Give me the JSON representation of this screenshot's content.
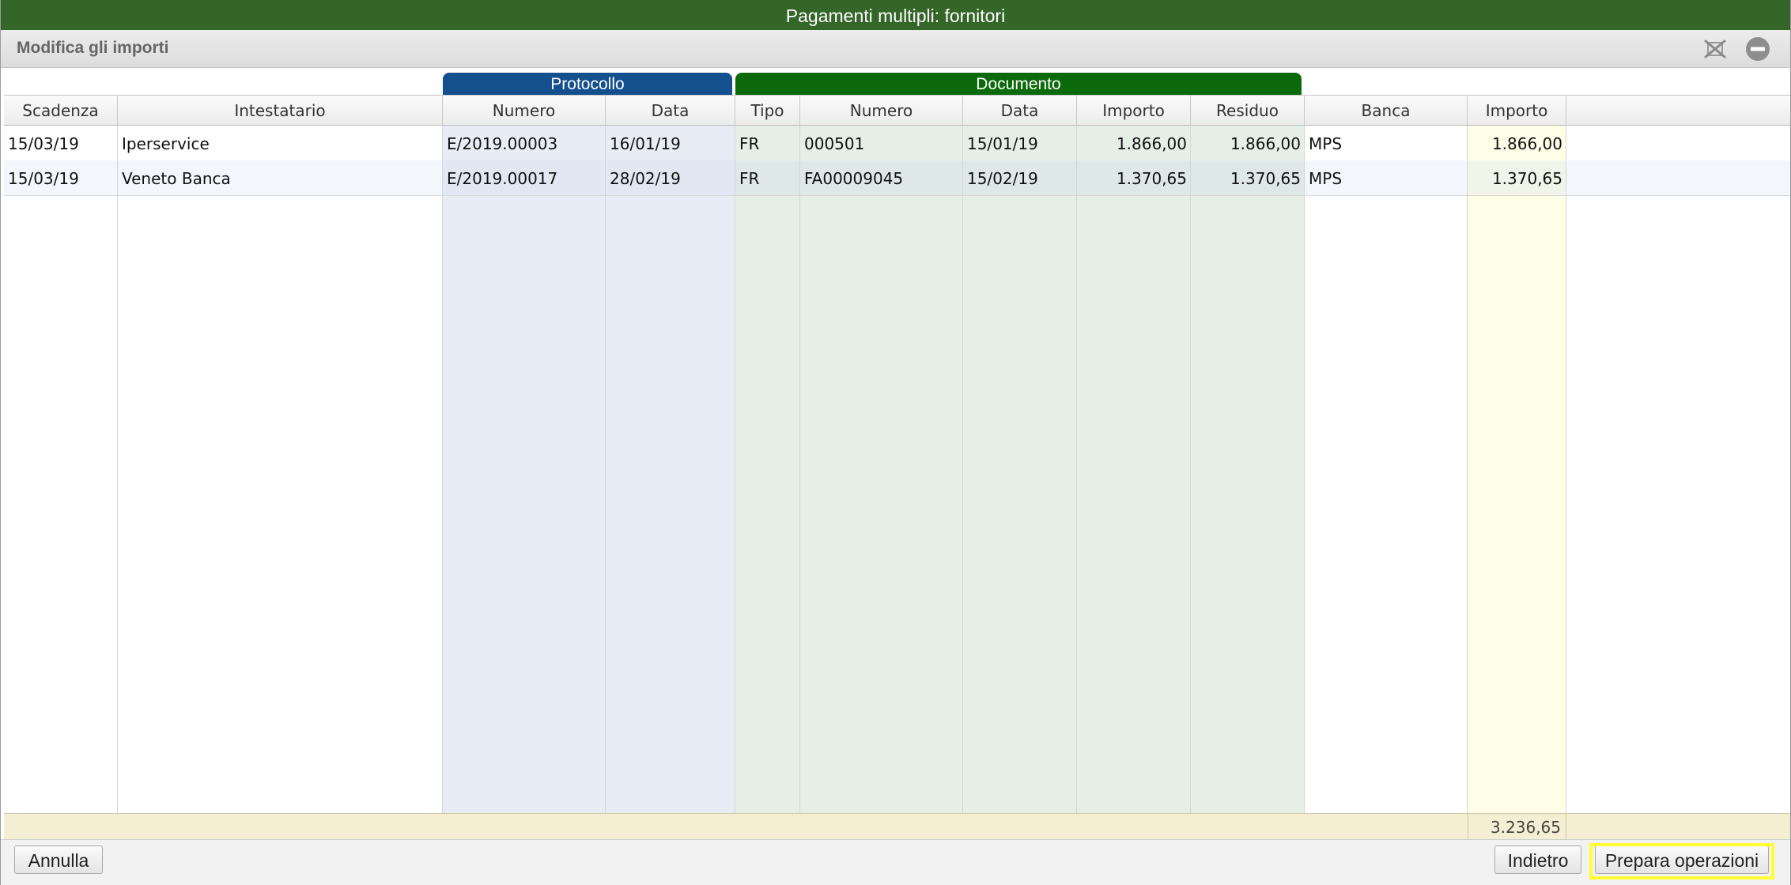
{
  "window": {
    "title": "Pagamenti multipli: fornitori"
  },
  "toolbar": {
    "subtitle": "Modifica gli importi",
    "icons": [
      "excel-export-icon",
      "remove-circle-icon"
    ]
  },
  "groups": {
    "protocollo": "Protocollo",
    "documento": "Documento"
  },
  "columns": {
    "scadenza": "Scadenza",
    "intestatario": "Intestatario",
    "prot_numero": "Numero",
    "prot_data": "Data",
    "tipo": "Tipo",
    "doc_numero": "Numero",
    "doc_data": "Data",
    "doc_importo": "Importo",
    "residuo": "Residuo",
    "banca": "Banca",
    "importo": "Importo"
  },
  "rows": [
    {
      "scadenza": "15/03/19",
      "intestatario": "Iperservice",
      "prot_numero": "E/2019.00003",
      "prot_data": "16/01/19",
      "tipo": "FR",
      "doc_numero": "000501",
      "doc_data": "15/01/19",
      "doc_importo": "1.866,00",
      "residuo": "1.866,00",
      "banca": "MPS",
      "importo": "1.866,00"
    },
    {
      "scadenza": "15/03/19",
      "intestatario": "Veneto Banca",
      "prot_numero": "E/2019.00017",
      "prot_data": "28/02/19",
      "tipo": "FR",
      "doc_numero": "FA00009045",
      "doc_data": "15/02/19",
      "doc_importo": "1.370,65",
      "residuo": "1.370,65",
      "banca": "MPS",
      "importo": "1.370,65"
    }
  ],
  "totals": {
    "importo": "3.236,65"
  },
  "footer": {
    "annulla": "Annulla",
    "indietro": "Indietro",
    "prepara": "Prepara operazioni"
  },
  "colors": {
    "titlebar": "#336628",
    "protocollo_header": "#14508e",
    "documento_header": "#0c6a0c",
    "highlight": "#ffff33"
  }
}
